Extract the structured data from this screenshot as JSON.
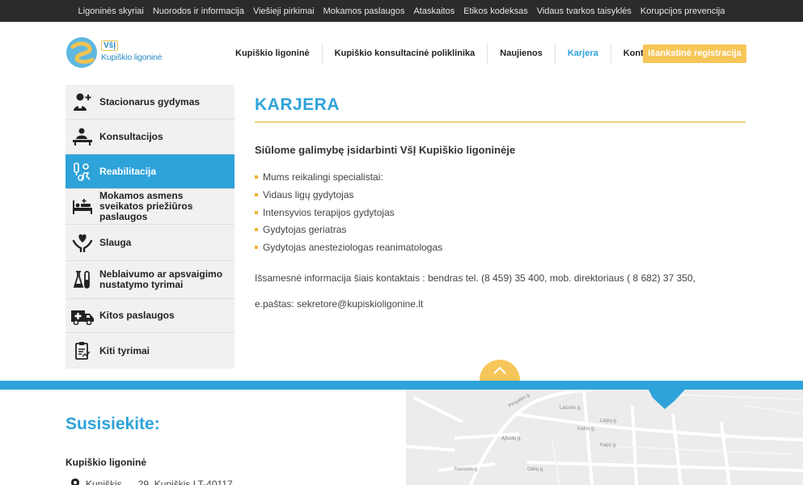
{
  "topbar": {
    "links": [
      "Ligoninės skyriai",
      "Nuorodos ir informacija",
      "Viešieji pirkimai",
      "Mokamos paslaugos",
      "Ataskaitos",
      "Etikos kodeksas",
      "Vidaus tvarkos taisyklės",
      "Korupcijos prevencija"
    ]
  },
  "logo": {
    "line1": "VšĮ",
    "line2": "Kupiškio ligoninė"
  },
  "mainnav": {
    "items": [
      "Kupiškio ligoninė",
      "Kupiškio konsultacinė poliklinika",
      "Naujienos",
      "Karjera",
      "Kontaktai"
    ],
    "active": "Karjera",
    "register_button": "Išankstinė registracija"
  },
  "sidebar": {
    "items": [
      {
        "label": "Stacionarus gydymas",
        "icon": "doctor-plus-icon"
      },
      {
        "label": "Konsultacijos",
        "icon": "consultation-icon"
      },
      {
        "label": "Reabilitacija",
        "icon": "rehabilitation-icon",
        "active": true
      },
      {
        "label": "Mokamos asmens sveikatos priežiūros paslaugos",
        "icon": "hospital-bed-icon"
      },
      {
        "label": "Slauga",
        "icon": "care-hands-heart-icon"
      },
      {
        "label": "Neblaivumo ar apsvaigimo nustatymo tyrimai",
        "icon": "test-tubes-icon"
      },
      {
        "label": "Kitos paslaugos",
        "icon": "ambulance-icon"
      },
      {
        "label": "Kiti tyrimai",
        "icon": "clipboard-icon"
      }
    ]
  },
  "content": {
    "title": "KARJERA",
    "subtitle": "Siūlome galimybę įsidarbinti VšĮ Kupiškio ligoninėje",
    "bullets": [
      "Mums reikalingi specialistai:",
      "Vidaus ligų gydytojas",
      "Intensyvios terapijos gydytojas",
      "Gydytojas geriatras",
      "Gydytojas anesteziologas reanimatologas"
    ],
    "info_line": "Išsamesnė informacija šiais kontaktais : bendras tel. (8 459) 35 400, mob. direktoriaus ( 8 682) 37 350,",
    "email_line": "e.paštas: sekretore@kupiskioligonine.lt"
  },
  "footer": {
    "title": "Susisiekite:",
    "org": "Kupiškio ligoninė",
    "address": "Kupiškis, ... 29, Kupiškis LT-40117"
  },
  "map": {
    "streets": [
      "Pergalės g.",
      "Laisvės g.",
      "Kalno g.",
      "Liepų g.",
      "Ąžuolų g.",
      "Kapų g.",
      "Maironio g.",
      "Gėlių g."
    ]
  },
  "colors": {
    "accent_blue": "#2ea3d9",
    "accent_yellow": "#f7c65a",
    "topbar_bg": "#2b2b2b"
  }
}
